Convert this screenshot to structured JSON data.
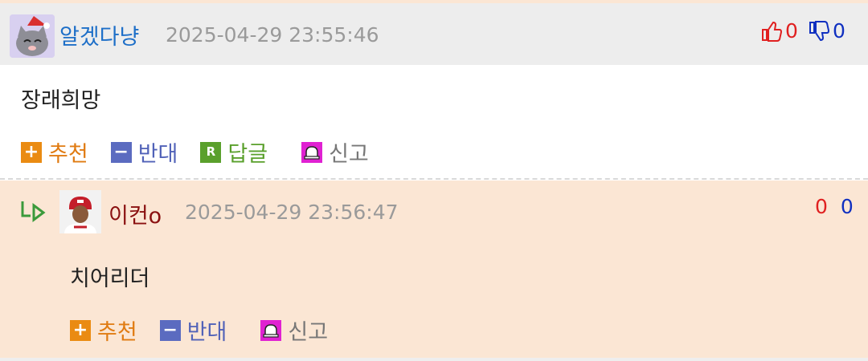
{
  "comment1": {
    "nickname": "알겠다냥",
    "datetime": "2025-04-29 23:55:46",
    "content": "장래희망",
    "upvotes": "0",
    "downvotes": "0",
    "actions": {
      "recommend": "추천",
      "oppose": "반대",
      "reply": "답글",
      "report": "신고"
    },
    "avatar_icon": "cat-avatar-icon"
  },
  "comment2": {
    "nickname": "이컨o",
    "datetime": "2025-04-29 23:56:47",
    "content": "치어리더",
    "upvotes": "0",
    "downvotes": "0",
    "actions": {
      "recommend": "추천",
      "oppose": "반대",
      "report": "신고"
    },
    "avatar_icon": "player-avatar-icon"
  },
  "colors": {
    "reply_bg": "#fbe6d4",
    "header_bg": "#ededed",
    "nick1": "#1e6fc8",
    "nick2": "#8a1010",
    "upvote": "#e02020",
    "downvote": "#1030c0"
  }
}
